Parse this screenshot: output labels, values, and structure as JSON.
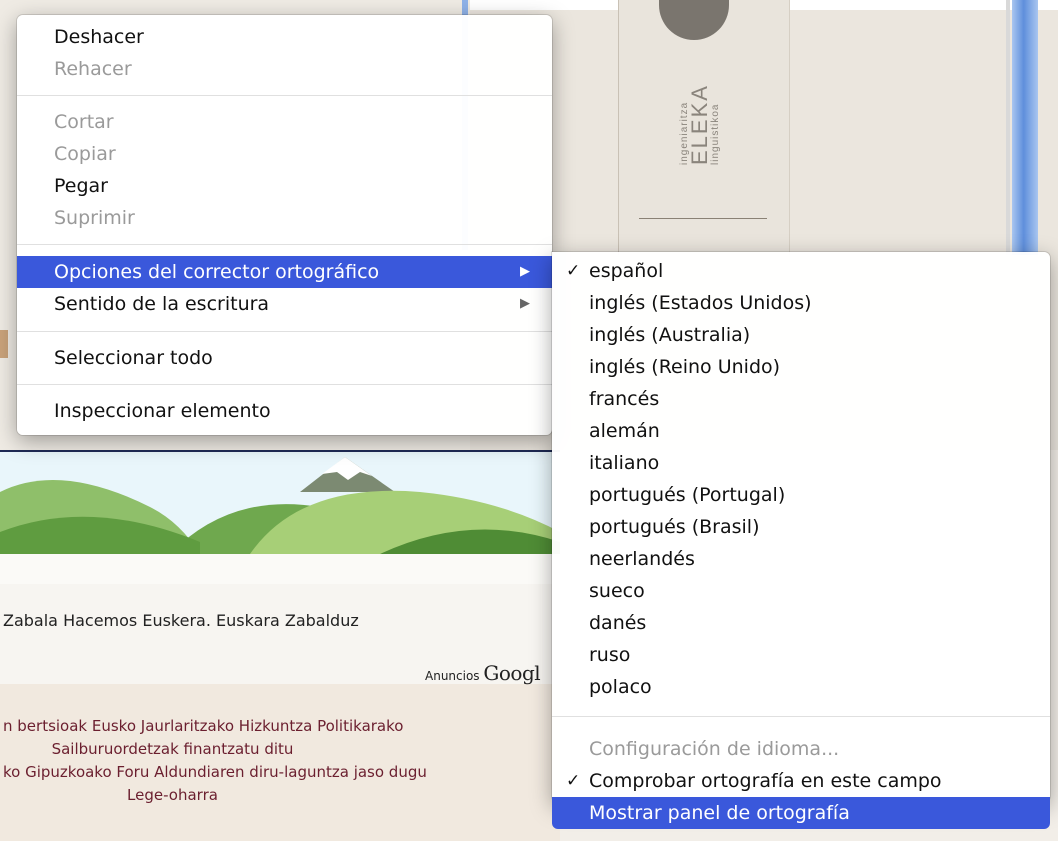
{
  "background": {
    "logo": {
      "small_top": "ingeniaritza",
      "brand": "ELEKA",
      "small_bottom": "linguistikoa"
    },
    "slogan": "Zabala Hacemos Euskera. Euskara Zabalduz",
    "ads": {
      "label": "Anuncios",
      "brand": "Googl"
    },
    "footer": [
      "n bertsioak Eusko Jaurlaritzako Hizkuntza Politikarako",
      "Sailburuordetzak finantzatu ditu",
      "ko Gipuzkoako Foru Aldundiaren diru-laguntza jaso dugu",
      "Lege-oharra"
    ]
  },
  "context_menu": {
    "undo": "Deshacer",
    "redo": "Rehacer",
    "cut": "Cortar",
    "copy": "Copiar",
    "paste": "Pegar",
    "delete": "Suprimir",
    "spelling_options": "Opciones del corrector ortográfico",
    "writing_direction": "Sentido de la escritura",
    "select_all": "Seleccionar todo",
    "inspect": "Inspeccionar elemento"
  },
  "spelling_submenu": {
    "languages": [
      "español",
      "inglés (Estados Unidos)",
      "inglés (Australia)",
      "inglés (Reino Unido)",
      "francés",
      "alemán",
      "italiano",
      "portugués (Portugal)",
      "portugués (Brasil)",
      "neerlandés",
      "sueco",
      "danés",
      "ruso",
      "polaco"
    ],
    "checked_language": "español",
    "language_settings": "Configuración de idioma...",
    "check_spelling_in_field": "Comprobar ortografía en este campo",
    "show_spelling_panel": "Mostrar panel de ortografía",
    "checkmark": "✓"
  },
  "colors": {
    "highlight": "#3a58db",
    "disabled_text": "#9a9a9a",
    "footer_text": "#6b1f2f"
  }
}
